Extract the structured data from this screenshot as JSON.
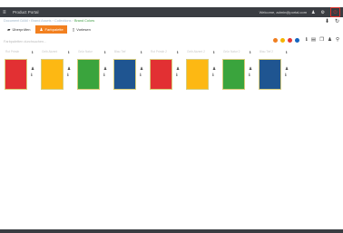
{
  "header": {
    "menu_icon": "hamburger-icon",
    "title": "Product Portal",
    "user_email": "Welcome, admin@portal.com",
    "icons": [
      "user-icon",
      "settings-icon",
      "power-icon"
    ]
  },
  "breadcrumb": {
    "items": [
      "Document DAM",
      "Brand Assets",
      "Collections"
    ],
    "separator": "›",
    "current": "Brand Colors"
  },
  "page_actions": [
    "download-icon",
    "refresh-icon"
  ],
  "tabs": [
    {
      "label": "Überprüfen",
      "icon": "briefcase-icon"
    },
    {
      "label": "Farbpalette",
      "icon": "user-icon"
    },
    {
      "label": "Vorlesen",
      "icon": "file-icon"
    }
  ],
  "filter_hint": "Farbpaletten durchsuchen...",
  "color_filters": [
    "#ef7e20",
    "#f5b400",
    "#e53935",
    "#1565c0"
  ],
  "toolbar_icons": [
    "info-icon",
    "document-icon",
    "copy-icon",
    "user-icon",
    "grid-icon"
  ],
  "cards": [
    {
      "caption": "Rot Primär",
      "color": "#e23033"
    },
    {
      "caption": "Gelb Akzent",
      "color": "#fdb813"
    },
    {
      "caption": "Grün Natur",
      "color": "#3aa43d"
    },
    {
      "caption": "Blau Tief",
      "color": "#1f5591"
    },
    {
      "caption": "Rot Primär 2",
      "color": "#e23033"
    },
    {
      "caption": "Gelb Akzent 2",
      "color": "#fdb813"
    },
    {
      "caption": "Grün Natur 2",
      "color": "#3aa43d"
    },
    {
      "caption": "Blau Tief 2",
      "color": "#1f5591"
    }
  ]
}
